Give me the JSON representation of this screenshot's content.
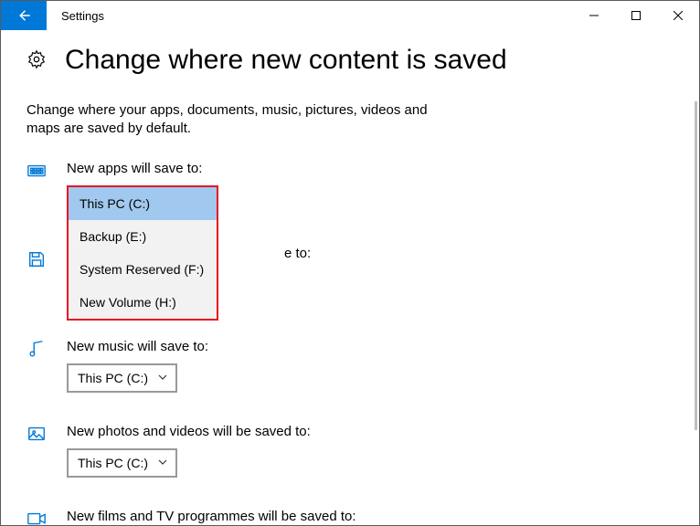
{
  "window": {
    "title": "Settings"
  },
  "page": {
    "heading": "Change where new content is saved",
    "description": "Change where your apps, documents, music, pictures, videos and maps are saved by default."
  },
  "sections": {
    "apps": {
      "label": "New apps will save to:"
    },
    "documents": {
      "partial_label": "e to:"
    },
    "music": {
      "label": "New music will save to:",
      "value": "This PC (C:)"
    },
    "photos": {
      "label": "New photos and videos will be saved to:",
      "value": "This PC (C:)"
    },
    "films": {
      "label": "New films and TV programmes will be saved to:"
    }
  },
  "dropdown": {
    "items": [
      {
        "label": "This PC (C:)",
        "selected": true
      },
      {
        "label": "Backup (E:)",
        "selected": false
      },
      {
        "label": "System Reserved (F:)",
        "selected": false
      },
      {
        "label": "New Volume (H:)",
        "selected": false
      }
    ]
  }
}
